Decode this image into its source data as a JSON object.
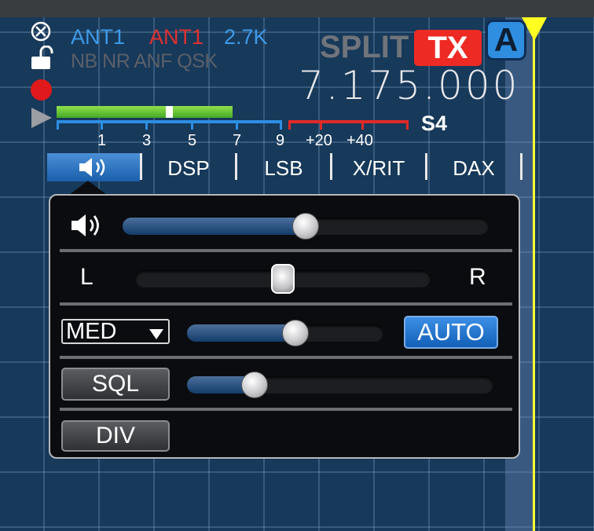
{
  "header": {
    "rx_antenna": "ANT1",
    "tx_antenna": "ANT1",
    "filter_width": "2.7K",
    "dsp_flags": "NB NR ANF QSK",
    "split_label": "SPLIT",
    "tx_badge": "TX",
    "slice_letter": "A",
    "frequency": "7.175.000"
  },
  "smeter": {
    "level_fraction": 0.5,
    "scale_labels": [
      "1",
      "3",
      "5",
      "7",
      "9",
      "+20",
      "+40"
    ],
    "reading": "S4"
  },
  "tabs": {
    "audio_icon": "speaker-icon",
    "dsp": "DSP",
    "mode": "LSB",
    "xrit": "X/RIT",
    "dax": "DAX"
  },
  "audio_panel": {
    "volume_percent": 50,
    "pan_left_label": "L",
    "pan_right_label": "R",
    "pan_percent": 50,
    "agc_mode": "MED",
    "agc_threshold_percent": 55,
    "auto_label": "AUTO",
    "squelch_label": "SQL",
    "squelch_percent": 22,
    "diversity_label": "DIV"
  },
  "colors": {
    "accent_blue": "#2d8ee3",
    "tx_red": "#ee2a24",
    "frequency_marker": "#ffff22"
  }
}
